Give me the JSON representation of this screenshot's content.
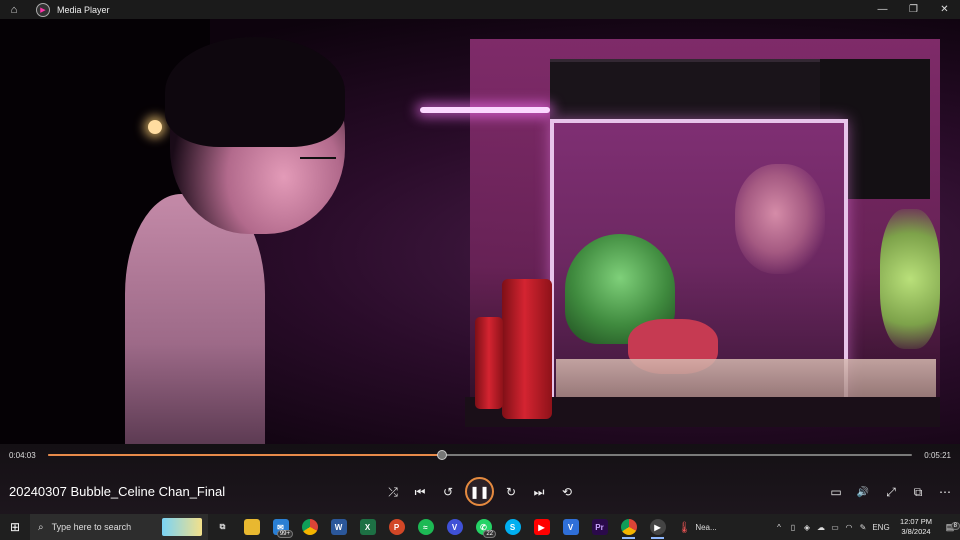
{
  "window": {
    "app_title": "Media Player",
    "minimize_icon": "—",
    "maximize_icon": "❐",
    "close_icon": "✕"
  },
  "player": {
    "elapsed": "0:04:03",
    "total": "0:05:21",
    "progress_fraction": 0.4565,
    "media_title": "20240307 Bubble_Celine Chan_Final",
    "accent_color": "#e88a4a"
  },
  "controls": {
    "shuffle": "⤮",
    "previous": "⏮",
    "rewind": "↺",
    "play_pause": "❚❚",
    "forward": "↻",
    "next": "⏭",
    "repeat": "⟲",
    "caption": "▭",
    "volume": "🔊",
    "fullscreen": "⤢",
    "miniplayer": "⧉",
    "more": "⋯"
  },
  "taskbar": {
    "search_placeholder": "Type here to search",
    "mail_badge": "99+",
    "whatsapp_badge": "22",
    "weather_label": "Nea...",
    "language": "ENG",
    "time": "12:07 PM",
    "date": "3/8/2024",
    "notification_badge": "8"
  }
}
